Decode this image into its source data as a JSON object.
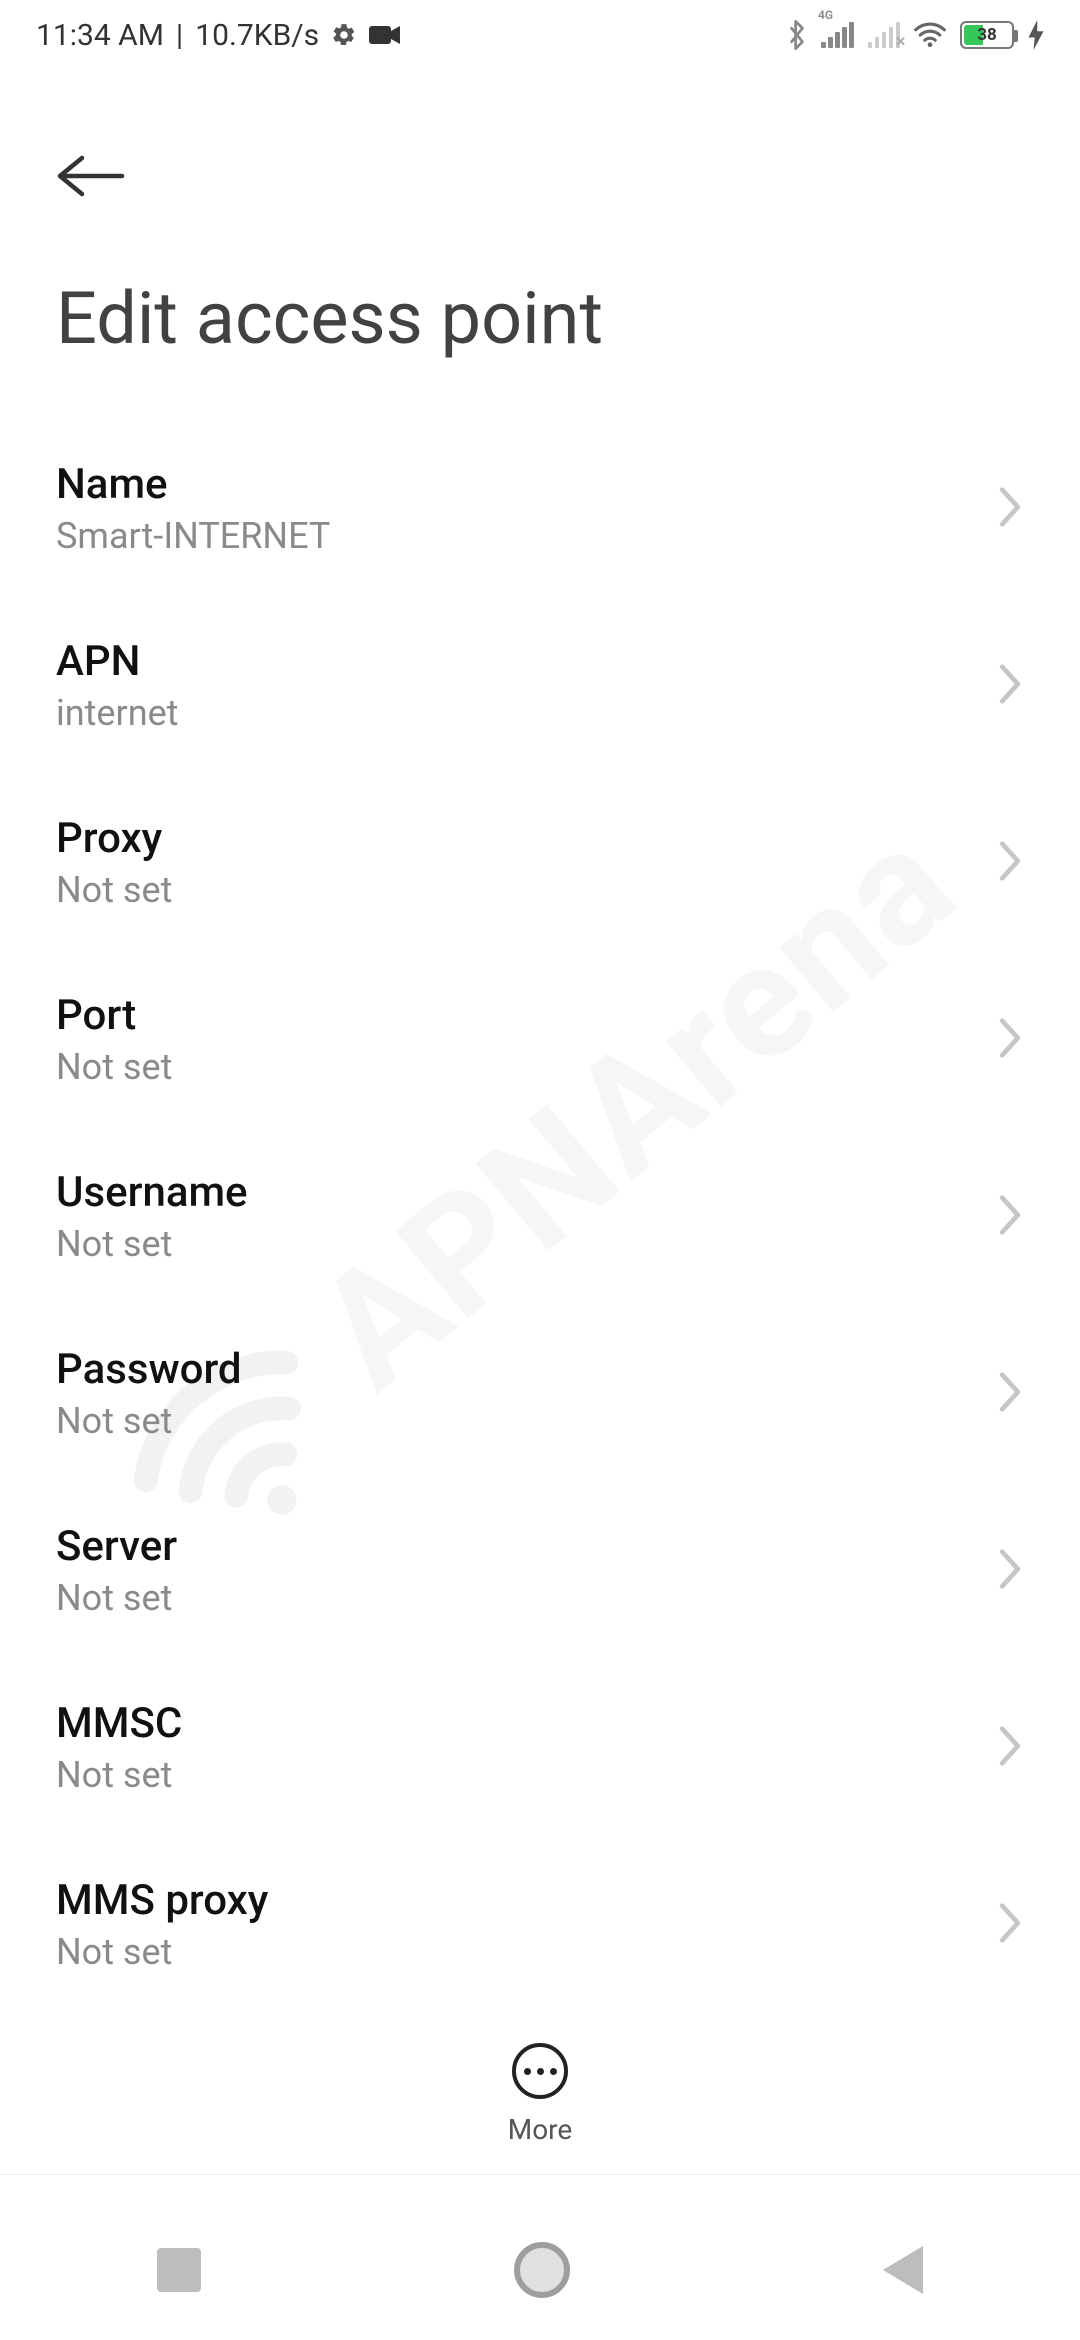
{
  "status_bar": {
    "time": "11:34 AM",
    "separator": "|",
    "net_speed": "10.7KB/s",
    "battery_percent": "38",
    "sim_type": "4G"
  },
  "header": {
    "title": "Edit access point"
  },
  "settings": [
    {
      "label": "Name",
      "value": "Smart-INTERNET"
    },
    {
      "label": "APN",
      "value": "internet"
    },
    {
      "label": "Proxy",
      "value": "Not set"
    },
    {
      "label": "Port",
      "value": "Not set"
    },
    {
      "label": "Username",
      "value": "Not set"
    },
    {
      "label": "Password",
      "value": "Not set"
    },
    {
      "label": "Server",
      "value": "Not set"
    },
    {
      "label": "MMSC",
      "value": "Not set"
    },
    {
      "label": "MMS proxy",
      "value": "Not set"
    }
  ],
  "more": {
    "label": "More"
  },
  "watermark": "APNArena"
}
